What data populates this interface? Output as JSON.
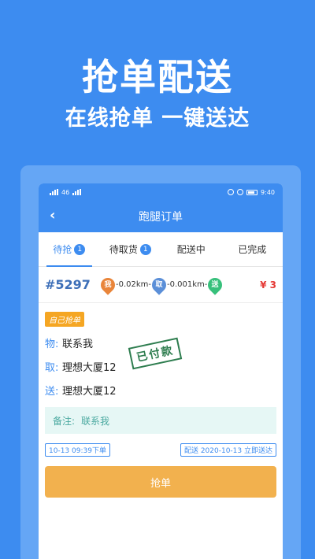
{
  "promo": {
    "title": "抢单配送",
    "subtitle": "在线抢单 一键送达"
  },
  "statusbar": {
    "left": "46",
    "time": "9:40"
  },
  "navbar": {
    "back": "‹",
    "title": "跑腿订单"
  },
  "tabs": [
    {
      "label": "待抢",
      "badge": "1"
    },
    {
      "label": "待取货",
      "badge": "1"
    },
    {
      "label": "配送中",
      "badge": ""
    },
    {
      "label": "已完成",
      "badge": ""
    }
  ],
  "order": {
    "number": "#5297",
    "pin_me": "我",
    "dist1": "-0.02km-",
    "pin_take": "取",
    "dist2": "-0.001km-",
    "pin_send": "送",
    "price": "¥ 3"
  },
  "card": {
    "self_tag": "自己抢单",
    "item_key": "物:",
    "item_val": "联系我",
    "pickup_key": "取:",
    "pickup_val": "理想大厦12",
    "delivery_key": "送:",
    "delivery_val": "理想大厦12",
    "stamp": "已付款",
    "remark_key": "备注:",
    "remark_val": "联系我",
    "order_time": "10-13 09:39下单",
    "delivery_time": "配送 2020-10-13 立即送达",
    "grab_button": "抢单"
  },
  "colors": {
    "primary": "#3d8cf0",
    "button": "#f2b14e",
    "price": "#e53935"
  }
}
